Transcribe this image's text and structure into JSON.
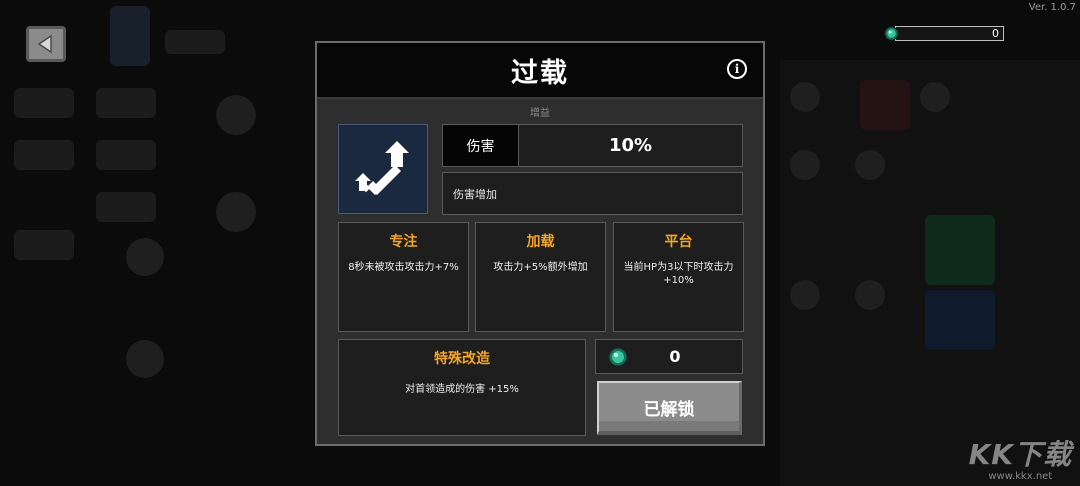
{
  "app": {
    "version": "Ver. 1.0.7"
  },
  "topbar": {
    "currency_value": "0"
  },
  "modal": {
    "title": "过载",
    "subtitle": "增益",
    "stat": {
      "label": "伤害",
      "value": "10%"
    },
    "description": "伤害增加",
    "perks": [
      {
        "title": "专注",
        "desc": "8秒未被攻击攻击力+7%"
      },
      {
        "title": "加载",
        "desc": "攻击力+5%额外增加"
      },
      {
        "title": "平台",
        "desc": "当前HP为3以下时攻击力+10%"
      }
    ],
    "special": {
      "title": "特殊改造",
      "desc": "对首领造成的伤害 +15%"
    },
    "cost": "0",
    "unlock_label": "已解锁"
  },
  "watermark": {
    "main": "KK下载",
    "sub": "www.kkx.net"
  },
  "colors": {
    "accent": "#f4a623",
    "icon_bg": "#1a2840",
    "gem": "#35c9a0"
  },
  "icons": {
    "back": "back-arrow-icon",
    "info": "info-icon",
    "gem": "gem-icon",
    "skill": "sword-upgrade-icon"
  }
}
